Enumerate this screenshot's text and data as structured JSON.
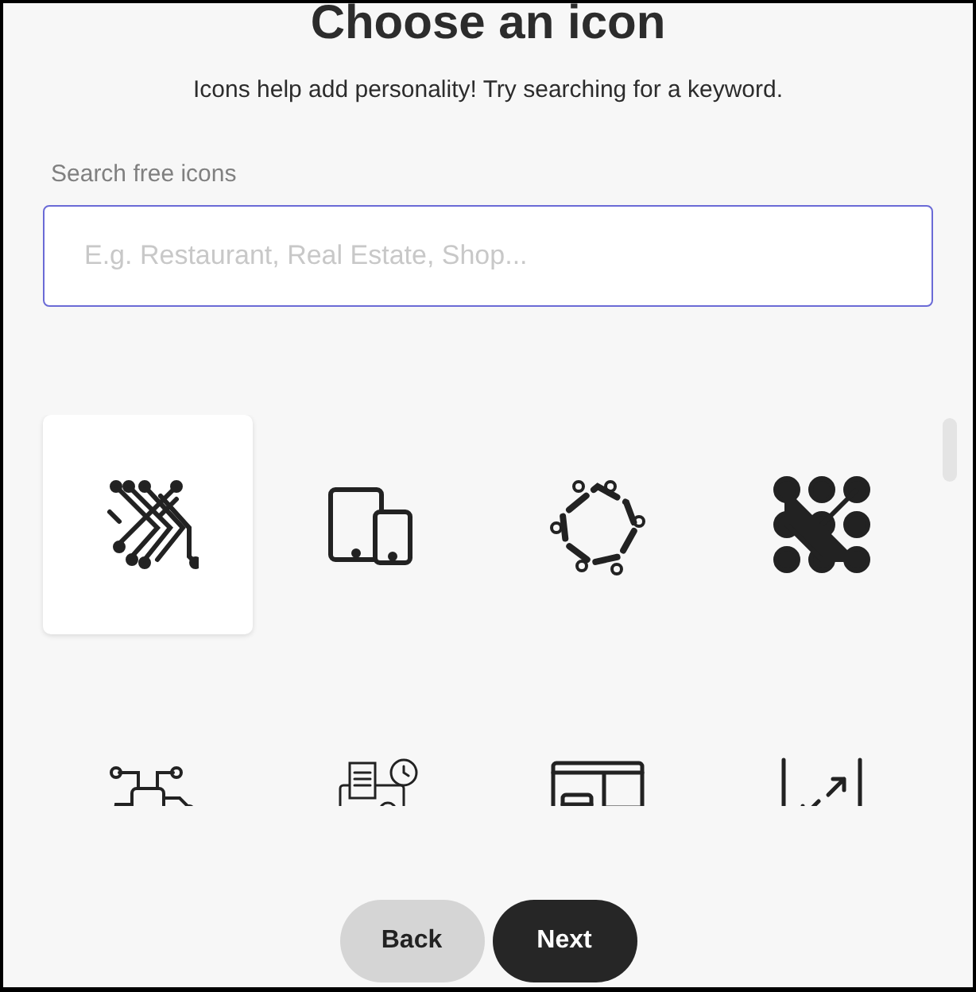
{
  "title": "Choose an icon",
  "subtitle": "Icons help add personality! Try searching for a keyword.",
  "search": {
    "label": "Search free icons",
    "placeholder": "E.g. Restaurant, Real Estate, Shop..."
  },
  "icons": [
    {
      "kind": "circuit-lines",
      "selected": true
    },
    {
      "kind": "devices",
      "selected": false
    },
    {
      "kind": "hexagon-circuit",
      "selected": false
    },
    {
      "kind": "dot-pattern",
      "selected": false
    },
    {
      "kind": "chip",
      "selected": false
    },
    {
      "kind": "presentation",
      "selected": false
    },
    {
      "kind": "layout",
      "selected": false
    },
    {
      "kind": "resize",
      "selected": false
    }
  ],
  "buttons": [
    {
      "label": "Back",
      "kind": "secondary"
    },
    {
      "label": "Next",
      "kind": "primary"
    }
  ]
}
